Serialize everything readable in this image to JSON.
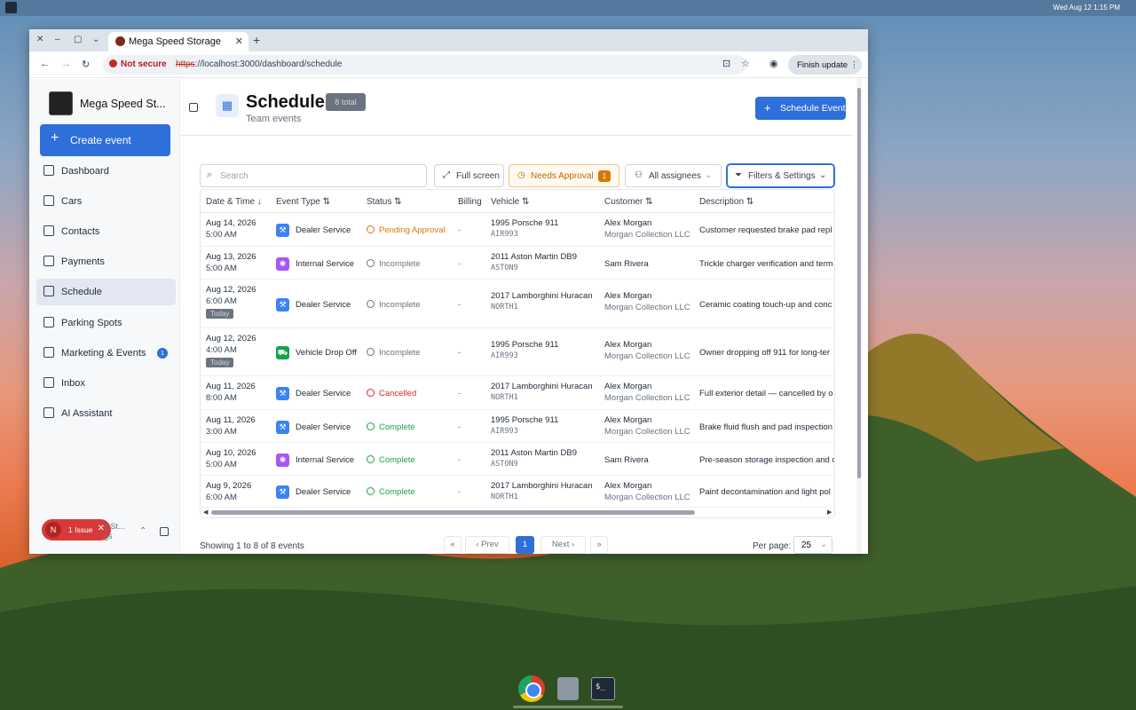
{
  "desktop": {
    "clock": "Wed Aug 12   1:15 PM"
  },
  "browser": {
    "tab_title": "Mega Speed Storage",
    "not_secure": "Not secure",
    "url_scheme": "https",
    "url_rest": "://localhost:3000/dashboard/schedule",
    "finish_update": "Finish update"
  },
  "sidebar": {
    "brand": "Mega Speed St...",
    "create": "Create event",
    "items": [
      {
        "label": "Dashboard",
        "icon": "grid-icon"
      },
      {
        "label": "Cars",
        "icon": "car-icon"
      },
      {
        "label": "Contacts",
        "icon": "users-icon"
      },
      {
        "label": "Payments",
        "icon": "card-icon"
      },
      {
        "label": "Schedule",
        "icon": "calendar-icon"
      },
      {
        "label": "Parking Spots",
        "icon": "pin-icon"
      },
      {
        "label": "Marketing & Events",
        "icon": "megaphone-icon",
        "badge": "1"
      },
      {
        "label": "Inbox",
        "icon": "inbox-icon"
      },
      {
        "label": "AI Assistant",
        "icon": "bot-icon"
      }
    ],
    "issue": {
      "letter": "N",
      "label": "1 Issue"
    },
    "footer_name": "d St...",
    "footer_sub": "gs"
  },
  "page": {
    "title": "Schedule",
    "count": "8 total",
    "subtitle": "Team events",
    "schedule_button": "Schedule Event"
  },
  "toolbar": {
    "search_placeholder": "Search",
    "full_screen": "Full screen",
    "needs_approval": "Needs Approval",
    "needs_approval_count": "1",
    "assignees": "All assignees",
    "filters": "Filters & Settings"
  },
  "table": {
    "columns": [
      "Date & Time",
      "Event Type",
      "Status",
      "Billing",
      "Vehicle",
      "Customer",
      "Description"
    ],
    "rows": [
      {
        "date": "Aug 14, 2026",
        "time": "5:00 AM",
        "today": "",
        "type": "Dealer Service",
        "status": "Pending Approval",
        "billing": "-",
        "vehicle": "1995 Porsche 911",
        "plate": "AIR993",
        "customer": "Alex Morgan",
        "company": "Morgan Collection LLC",
        "desc": "Customer requested brake pad repl"
      },
      {
        "date": "Aug 13, 2026",
        "time": "5:00 AM",
        "today": "",
        "type": "Internal Service",
        "status": "Incomplete",
        "billing": "-",
        "vehicle": "2011 Aston Martin DB9",
        "plate": "ASTON9",
        "customer": "Sam Rivera",
        "company": "",
        "desc": "Trickle charger verification and term"
      },
      {
        "date": "Aug 12, 2026",
        "time": "6:00 AM",
        "today": "Today",
        "type": "Dealer Service",
        "status": "Incomplete",
        "billing": "-",
        "vehicle": "2017 Lamborghini Huracan",
        "plate": "NORTH1",
        "customer": "Alex Morgan",
        "company": "Morgan Collection LLC",
        "desc": "Ceramic coating touch-up and conc"
      },
      {
        "date": "Aug 12, 2026",
        "time": "4:00 AM",
        "today": "Today",
        "type": "Vehicle Drop Off",
        "status": "Incomplete",
        "billing": "-",
        "vehicle": "1995 Porsche 911",
        "plate": "AIR993",
        "customer": "Alex Morgan",
        "company": "Morgan Collection LLC",
        "desc": "Owner dropping off 911 for long-ter"
      },
      {
        "date": "Aug 11, 2026",
        "time": "8:00 AM",
        "today": "",
        "type": "Dealer Service",
        "status": "Cancelled",
        "billing": "-",
        "vehicle": "2017 Lamborghini Huracan",
        "plate": "NORTH1",
        "customer": "Alex Morgan",
        "company": "Morgan Collection LLC",
        "desc": "Full exterior detail — cancelled by o"
      },
      {
        "date": "Aug 11, 2026",
        "time": "3:00 AM",
        "today": "",
        "type": "Dealer Service",
        "status": "Complete",
        "billing": "-",
        "vehicle": "1995 Porsche 911",
        "plate": "AIR993",
        "customer": "Alex Morgan",
        "company": "Morgan Collection LLC",
        "desc": "Brake fluid flush and pad inspection"
      },
      {
        "date": "Aug 10, 2026",
        "time": "5:00 AM",
        "today": "",
        "type": "Internal Service",
        "status": "Complete",
        "billing": "-",
        "vehicle": "2011 Aston Martin DB9",
        "plate": "ASTON9",
        "customer": "Sam Rivera",
        "company": "",
        "desc": "Pre-season storage inspection and c"
      },
      {
        "date": "Aug 9, 2026",
        "time": "6:00 AM",
        "today": "",
        "type": "Dealer Service",
        "status": "Complete",
        "billing": "-",
        "vehicle": "2017 Lamborghini Huracan",
        "plate": "NORTH1",
        "customer": "Alex Morgan",
        "company": "Morgan Collection LLC",
        "desc": "Paint decontamination and light pol"
      }
    ]
  },
  "type_colors": {
    "Dealer Service": "#3b82f6",
    "Internal Service": "#a855f7",
    "Vehicle Drop Off": "#16a34a"
  },
  "status_colors": {
    "Pending Approval": "#d97706",
    "Incomplete": "#6b7280",
    "Cancelled": "#dc2626",
    "Complete": "#16a34a"
  },
  "pagination": {
    "showing": "Showing 1 to 8 of 8 events",
    "first": "«",
    "prev": "Prev",
    "page": "1",
    "next": "Next",
    "last": "»",
    "per_page_label": "Per page:",
    "per_page": "25"
  }
}
